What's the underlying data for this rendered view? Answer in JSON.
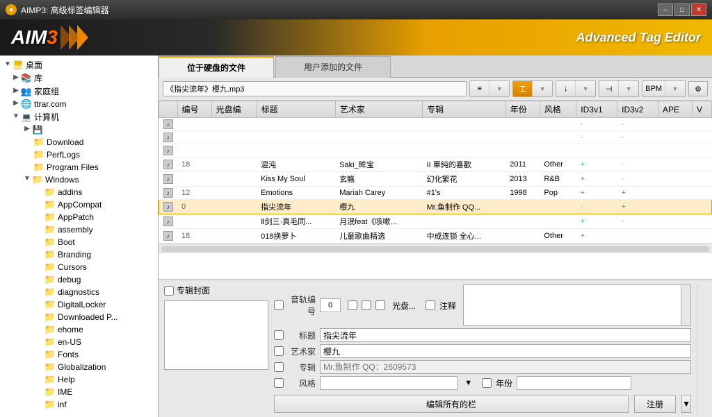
{
  "titlebar": {
    "title": "AIMP3: 高级标签编辑器",
    "min_label": "–",
    "max_label": "□",
    "close_label": "✕"
  },
  "header": {
    "logo": "AIMP",
    "logo_num": "3",
    "subtitle": "Advanced Tag Editor",
    "arrows": [
      "▶",
      "▶",
      "▶"
    ]
  },
  "tabs": [
    {
      "label": "位于硬盘的文件",
      "active": true
    },
    {
      "label": "用户添加的文件",
      "active": false
    }
  ],
  "toolbar": {
    "file_path": "《指尖流年》樱九.mp3",
    "btn_list": "≡",
    "btn_edit": "工",
    "btn_down": "↓",
    "btn_dash": "⊣",
    "btn_bpm": "BPM",
    "btn_gear": "⚙"
  },
  "table": {
    "columns": [
      "",
      "编号",
      "光盘编",
      "标题",
      "艺术家",
      "专辑",
      "年份",
      "风格",
      "ID3v1",
      "ID3v2",
      "APE",
      "V"
    ],
    "rows": [
      {
        "icon": "tag",
        "num": "",
        "disc": "",
        "title": "",
        "artist": "",
        "album": "",
        "year": "",
        "genre": "",
        "id3v1": "-",
        "id3v2": "-",
        "ape": "",
        "v": "",
        "selected": false
      },
      {
        "icon": "tag",
        "num": "",
        "disc": "",
        "title": "",
        "artist": "",
        "album": "",
        "year": "",
        "genre": "",
        "id3v1": "-",
        "id3v2": "-",
        "ape": "",
        "v": "",
        "selected": false
      },
      {
        "icon": "tag",
        "num": "",
        "disc": "",
        "title": "",
        "artist": "",
        "album": "",
        "year": "",
        "genre": "",
        "id3v1": "",
        "id3v2": "",
        "ape": "",
        "v": "",
        "selected": false
      },
      {
        "icon": "tag",
        "num": "18",
        "disc": "",
        "title": "混沌",
        "artist": "Saki_眸宝",
        "album": "II 單純的喜歡",
        "year": "2011",
        "genre": "Other",
        "id3v1": "+",
        "id3v2": "-",
        "ape": "",
        "v": "",
        "selected": false
      },
      {
        "icon": "tag",
        "num": "",
        "disc": "",
        "title": "Kiss My Soul",
        "artist": "玄觞",
        "album": "幻化繁花",
        "year": "2013",
        "genre": "R&B",
        "id3v1": "+",
        "id3v2": "-",
        "ape": "",
        "v": "",
        "selected": false
      },
      {
        "icon": "tag",
        "num": "12",
        "disc": "",
        "title": "Emotions",
        "artist": "Mariah Carey",
        "album": "#1's",
        "year": "1998",
        "genre": "Pop",
        "id3v1": "+",
        "id3v2": "+",
        "ape": "",
        "v": "",
        "selected": false
      },
      {
        "icon": "tag",
        "num": "0",
        "disc": "",
        "title": "指尖流年",
        "artist": "樱九",
        "album": "Mr.鱼制作 QQ...",
        "year": "",
        "genre": "",
        "id3v1": "-",
        "id3v2": "+",
        "ape": "",
        "v": "",
        "selected": true
      },
      {
        "icon": "tag",
        "num": "",
        "disc": "",
        "title": "Ⅱ剑三·真毛同...",
        "artist": "月泯feat《咳嗽...",
        "album": "",
        "year": "",
        "genre": "",
        "id3v1": "+",
        "id3v2": "-",
        "ape": "",
        "v": "",
        "selected": false
      },
      {
        "icon": "tag",
        "num": "18",
        "disc": "",
        "title": "018换萝卜",
        "artist": "儿童歌曲精选",
        "album": "中成连锁 全心...",
        "year": "",
        "genre": "Other",
        "id3v1": "+",
        "id3v2": "",
        "ape": "",
        "v": "",
        "selected": false
      }
    ]
  },
  "sidebar": {
    "items": [
      {
        "label": "桌面",
        "level": 0,
        "expanded": true,
        "icon": "desktop",
        "hasArrow": true
      },
      {
        "label": "库",
        "level": 1,
        "expanded": false,
        "icon": "folder",
        "hasArrow": true
      },
      {
        "label": "家庭组",
        "level": 1,
        "expanded": false,
        "icon": "folder",
        "hasArrow": true
      },
      {
        "label": "ttrar.com",
        "level": 1,
        "expanded": false,
        "icon": "folder",
        "hasArrow": true
      },
      {
        "label": "计算机",
        "level": 1,
        "expanded": true,
        "icon": "computer",
        "hasArrow": true
      },
      {
        "label": "(drive)",
        "level": 2,
        "expanded": false,
        "icon": "drive",
        "hasArrow": false
      },
      {
        "label": "Download",
        "level": 3,
        "expanded": false,
        "icon": "folder",
        "hasArrow": false
      },
      {
        "label": "PerfLogs",
        "level": 3,
        "expanded": false,
        "icon": "folder",
        "hasArrow": false
      },
      {
        "label": "Program Files",
        "level": 3,
        "expanded": false,
        "icon": "folder",
        "hasArrow": false
      },
      {
        "label": "Windows",
        "level": 3,
        "expanded": true,
        "icon": "folder",
        "hasArrow": true
      },
      {
        "label": "addins",
        "level": 4,
        "expanded": false,
        "icon": "folder",
        "hasArrow": false
      },
      {
        "label": "AppCompat",
        "level": 4,
        "expanded": false,
        "icon": "folder",
        "hasArrow": false
      },
      {
        "label": "AppPatch",
        "level": 4,
        "expanded": false,
        "icon": "folder",
        "hasArrow": false
      },
      {
        "label": "assembly",
        "level": 4,
        "expanded": false,
        "icon": "folder",
        "hasArrow": false,
        "selected": false
      },
      {
        "label": "Boot",
        "level": 4,
        "expanded": false,
        "icon": "folder",
        "hasArrow": false
      },
      {
        "label": "Branding",
        "level": 4,
        "expanded": false,
        "icon": "folder",
        "hasArrow": false
      },
      {
        "label": "Cursors",
        "level": 4,
        "expanded": false,
        "icon": "folder",
        "hasArrow": false
      },
      {
        "label": "debug",
        "level": 4,
        "expanded": false,
        "icon": "folder",
        "hasArrow": false
      },
      {
        "label": "diagnostics",
        "level": 4,
        "expanded": false,
        "icon": "folder",
        "hasArrow": false
      },
      {
        "label": "DigitalLocker",
        "level": 4,
        "expanded": false,
        "icon": "folder",
        "hasArrow": false
      },
      {
        "label": "Downloaded P...",
        "level": 4,
        "expanded": false,
        "icon": "folder",
        "hasArrow": false
      },
      {
        "label": "ehome",
        "level": 4,
        "expanded": false,
        "icon": "folder",
        "hasArrow": false
      },
      {
        "label": "en-US",
        "level": 4,
        "expanded": false,
        "icon": "folder",
        "hasArrow": false
      },
      {
        "label": "Fonts",
        "level": 4,
        "expanded": false,
        "icon": "folder",
        "hasArrow": false
      },
      {
        "label": "Globalization",
        "level": 4,
        "expanded": false,
        "icon": "folder",
        "hasArrow": false
      },
      {
        "label": "Help",
        "level": 4,
        "expanded": false,
        "icon": "folder",
        "hasArrow": false
      },
      {
        "label": "IME",
        "level": 4,
        "expanded": false,
        "icon": "folder",
        "hasArrow": false
      },
      {
        "label": "inf",
        "level": 4,
        "expanded": false,
        "icon": "folder",
        "hasArrow": false
      }
    ]
  },
  "metadata": {
    "cover_label": "专辑封面",
    "tracknum_label": "音轨编号",
    "tracknum_value": "0",
    "disc_label": "光盘...",
    "note_label": "注释",
    "title_label": "标题",
    "title_value": "指尖流年",
    "artist_label": "艺术家",
    "artist_value": "樱九",
    "album_label": "专辑",
    "album_placeholder": "Mr.鱼制作 QQ：2609573",
    "genre_label": "风格",
    "year_label": "年份",
    "edit_all_btn": "编辑所有的栏",
    "register_btn": "注册",
    "dropdown_btn": "▼"
  }
}
